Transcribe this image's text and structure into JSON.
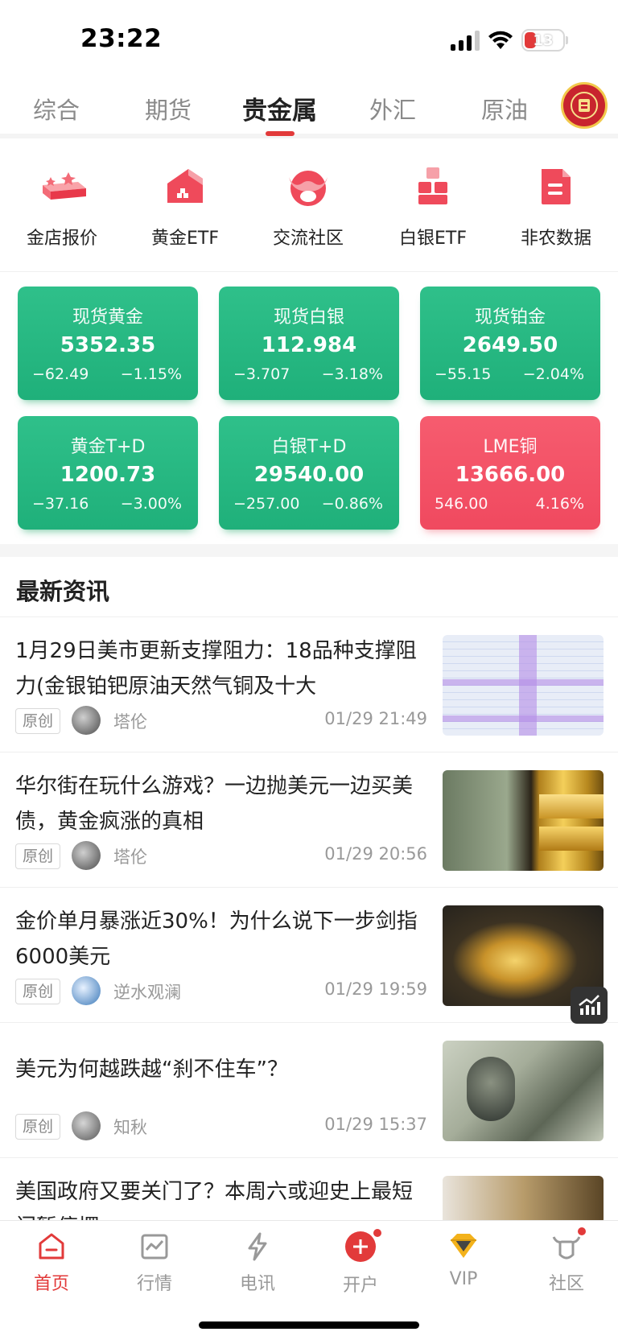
{
  "status": {
    "time": "23:22",
    "battery": "13"
  },
  "tabs": [
    {
      "label": "综合"
    },
    {
      "label": "期货"
    },
    {
      "label": "贵金属"
    },
    {
      "label": "外汇"
    },
    {
      "label": "原油"
    }
  ],
  "quick": [
    {
      "label": "金店报价",
      "icon": "gold-bars-icon"
    },
    {
      "label": "黄金ETF",
      "icon": "gold-etf-icon"
    },
    {
      "label": "交流社区",
      "icon": "bull-community-icon"
    },
    {
      "label": "白银ETF",
      "icon": "silver-etf-icon"
    },
    {
      "label": "非农数据",
      "icon": "document-icon"
    }
  ],
  "cards": [
    {
      "name": "现货黄金",
      "price": "5352.35",
      "change": "−62.49",
      "pct": "−1.15%"
    },
    {
      "name": "现货白银",
      "price": "112.984",
      "change": "−3.707",
      "pct": "−3.18%"
    },
    {
      "name": "现货铂金",
      "price": "2649.50",
      "change": "−55.15",
      "pct": "−2.04%"
    },
    {
      "name": "黄金T+D",
      "price": "1200.73",
      "change": "−37.16",
      "pct": "−3.00%"
    },
    {
      "name": "白银T+D",
      "price": "29540.00",
      "change": "−257.00",
      "pct": "−0.86%"
    },
    {
      "name": "LME铜",
      "price": "13666.00",
      "change": "546.00",
      "pct": "4.16%"
    }
  ],
  "colors": {
    "down": "#22b77f",
    "up": "#f2566a",
    "accent": "#e23a3a"
  },
  "news_section": {
    "title": "最新资讯"
  },
  "news": [
    {
      "title": "1月29日美市更新支撑阻力：18品种支撑阻力(金银铂钯原油天然气铜及十大",
      "tag": "原创",
      "author": "塔伦",
      "time": "01/29 21:49"
    },
    {
      "title": "华尔街在玩什么游戏？一边抛美元一边买美债，黄金疯涨的真相",
      "tag": "原创",
      "author": "塔伦",
      "time": "01/29 20:56"
    },
    {
      "title": "金价单月暴涨近30%！为什么说下一步剑指6000美元",
      "tag": "原创",
      "author": "逆水观澜",
      "time": "01/29 19:59"
    },
    {
      "title": "美元为何越跌越“刹不住车”？",
      "tag": "原创",
      "author": "知秋",
      "time": "01/29 15:37"
    },
    {
      "title": "美国政府又要关门了？本周六或迎史上最短门暂停摆",
      "tag": "",
      "author": "",
      "time": ""
    }
  ],
  "nav": [
    {
      "label": "首页"
    },
    {
      "label": "行情"
    },
    {
      "label": "电讯"
    },
    {
      "label": "开户"
    },
    {
      "label": "VIP"
    },
    {
      "label": "社区"
    }
  ]
}
